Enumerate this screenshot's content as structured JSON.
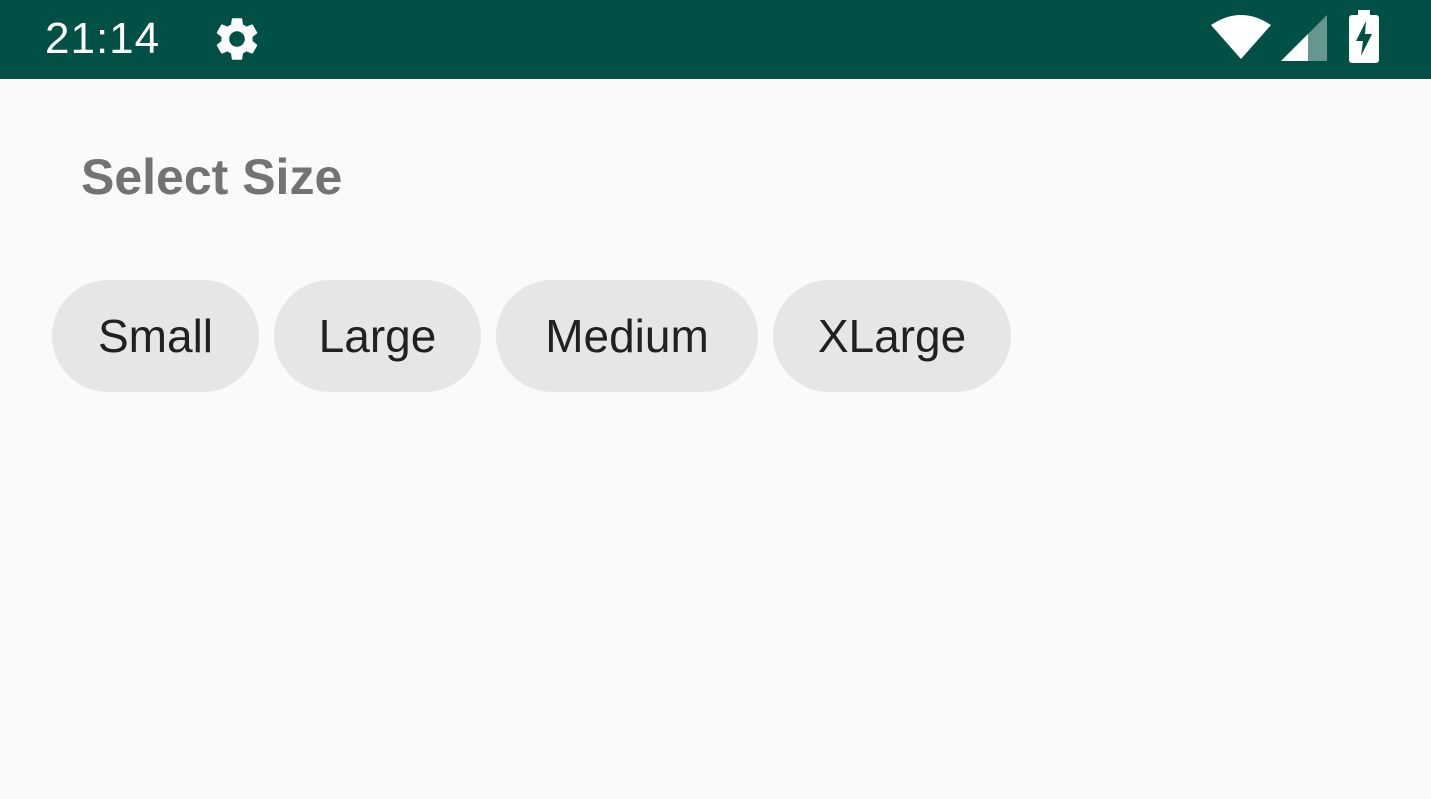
{
  "status_bar": {
    "time": "21:14",
    "icons": [
      "gear-icon",
      "wifi-icon",
      "cell-signal-icon",
      "battery-charging-icon"
    ],
    "background_color": "#005045"
  },
  "page": {
    "title": "Select Size"
  },
  "chips": [
    {
      "label": "Small"
    },
    {
      "label": "Large"
    },
    {
      "label": "Medium"
    },
    {
      "label": "XLarge"
    }
  ],
  "colors": {
    "chip_background": "#e6e6e6",
    "title_text": "#737373",
    "chip_text": "#212121"
  }
}
